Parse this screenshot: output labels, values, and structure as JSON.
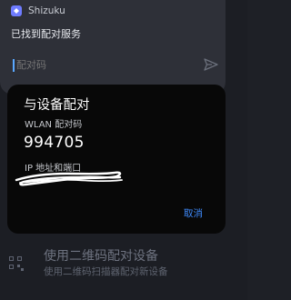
{
  "notification": {
    "app_name": "Shizuku",
    "message": "已找到配对服务",
    "reply_placeholder": "配对码",
    "send_icon": "send-icon",
    "app_icon": "shizuku-icon"
  },
  "dialog": {
    "title": "与设备配对",
    "wlan_label": "WLAN 配对码",
    "pairing_code": "994705",
    "ip_label": "IP 地址和端口",
    "cancel_label": "取消"
  },
  "background_item": {
    "title": "使用二维码配对设备",
    "subtitle": "使用二维码扫描器配对新设备",
    "icon": "qr-code-icon"
  },
  "colors": {
    "accent": "#3f8cff",
    "dialog_bg": "#080808",
    "notification_bg": "#2e3038",
    "app_icon": "#6f7cff"
  }
}
